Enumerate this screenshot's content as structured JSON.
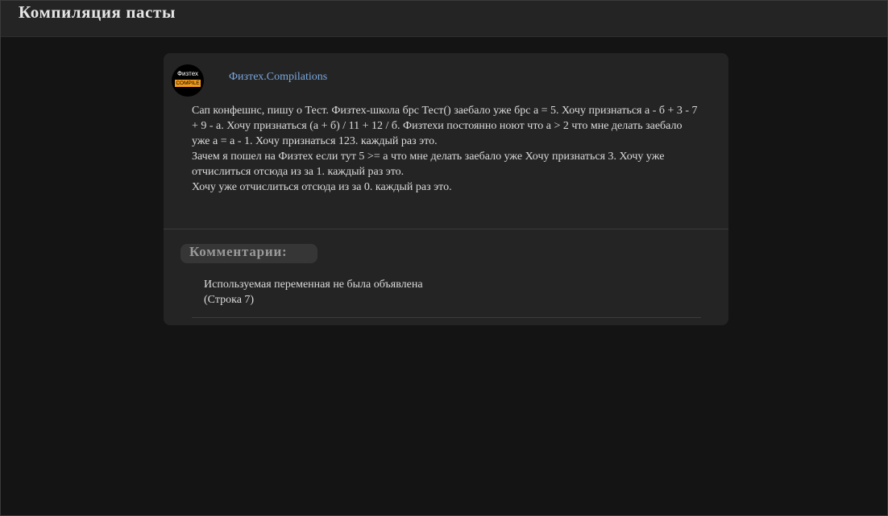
{
  "header": {
    "title": "Компиляция пасты"
  },
  "post": {
    "avatar": {
      "top_text": "Физтех",
      "badge_text": "COMPILE",
      "badge_color": "#f39a1d"
    },
    "author": "Физтех.Compilations",
    "paragraphs": [
      "Сап конфешнс, пишу о Тест. Физтех-школа брс Тест() заебало уже брс а = 5. Хочу признаться а - б + 3 - 7 + 9 - а. Хочу признаться (а + б) / 11 + 12 / б. Физтехи постоянно ноют что а > 2 что мне делать заебало уже а = а - 1. Хочу признаться 123. каждый раз это.",
      "Зачем я пошел на Физтех если тут 5 >= а что мне делать заебало уже Хочу признаться 3. Хочу уже отчислиться отсюда из за 1. каждый раз это.",
      "Хочу уже отчислиться отсюда из за 0. каждый раз это."
    ]
  },
  "comments": {
    "title": "Комментарии:",
    "items": [
      {
        "message": "Используемая переменная не была объявлена",
        "location": "(Строка 7)"
      }
    ]
  },
  "colors": {
    "page_background": "#141414",
    "header_background": "#242424",
    "card_background": "#242424",
    "link": "#7aa7dc"
  }
}
